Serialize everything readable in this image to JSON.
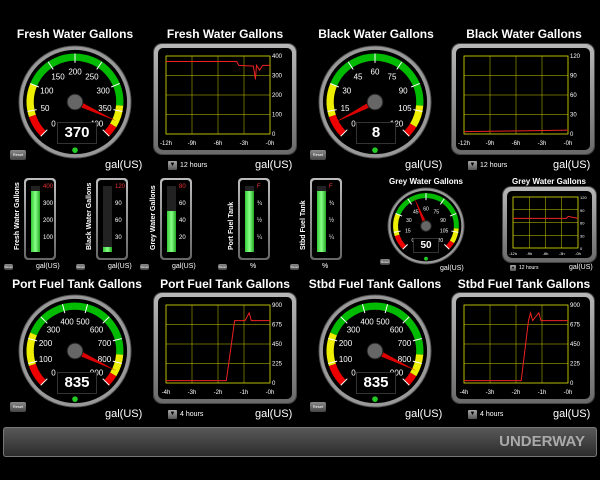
{
  "gauges": [
    {
      "id": "fresh",
      "title": "Fresh Water Gallons",
      "value": "370",
      "unit": "gal(US)",
      "max": 400,
      "ticks": [
        "0",
        "50",
        "100",
        "150",
        "200",
        "250",
        "300",
        "350",
        "400"
      ],
      "needle": 370
    },
    {
      "id": "black",
      "title": "Black Water Gallons",
      "value": "8",
      "unit": "gal(US)",
      "max": 120,
      "ticks": [
        "0",
        "15",
        "30",
        "45",
        "60",
        "75",
        "90",
        "105",
        "120"
      ],
      "needle": 8
    },
    {
      "id": "port",
      "title": "Port Fuel Tank Gallons",
      "value": "835",
      "unit": "gal(US)",
      "max": 900,
      "ticks": [
        "0",
        "100",
        "200",
        "300",
        "400",
        "500",
        "600",
        "700",
        "800",
        "900"
      ],
      "needle": 835
    },
    {
      "id": "stbd",
      "title": "Stbd Fuel Tank Gallons",
      "value": "835",
      "unit": "gal(US)",
      "max": 900,
      "ticks": [
        "0",
        "100",
        "200",
        "300",
        "400",
        "500",
        "600",
        "700",
        "800",
        "900"
      ],
      "needle": 835
    },
    {
      "id": "grey",
      "title": "Grey Water Gallons",
      "value": "50",
      "unit": "gal(US)",
      "max": 120,
      "ticks": [
        "0",
        "15",
        "30",
        "45",
        "60",
        "75",
        "90",
        "105",
        "120"
      ],
      "needle": 50
    }
  ],
  "trends": [
    {
      "id": "fresh",
      "title": "Fresh Water Gallons",
      "unit": "gal(US)",
      "range": "12 hours",
      "yticks": [
        "0",
        "100",
        "200",
        "300",
        "400"
      ],
      "xticks": [
        "-12h",
        "-9h",
        "-6h",
        "-3h",
        "-0h"
      ]
    },
    {
      "id": "black",
      "title": "Black Water Gallons",
      "unit": "gal(US)",
      "range": "12 hours",
      "yticks": [
        "0",
        "30",
        "60",
        "90",
        "120"
      ],
      "xticks": [
        "-12h",
        "-9h",
        "-6h",
        "-3h",
        "-0h"
      ]
    },
    {
      "id": "grey",
      "title": "Grey Water Gallons",
      "unit": "gal(US)",
      "range": "12 hours",
      "yticks": [
        "0",
        "30",
        "60",
        "90",
        "120"
      ],
      "xticks": [
        "-12h",
        "-9h",
        "-6h",
        "-3h",
        "-0h"
      ]
    },
    {
      "id": "port",
      "title": "Port Fuel Tank Gallons",
      "unit": "gal(US)",
      "range": "4 hours",
      "yticks": [
        "0",
        "225",
        "450",
        "675",
        "900"
      ],
      "xticks": [
        "-4h",
        "-3h",
        "-2h",
        "-1h",
        "-0h"
      ]
    },
    {
      "id": "stbd",
      "title": "Stbd Fuel Tank Gallons",
      "unit": "gal(US)",
      "range": "4 hours",
      "yticks": [
        "0",
        "225",
        "450",
        "675",
        "900"
      ],
      "xticks": [
        "-4h",
        "-3h",
        "-2h",
        "-1h",
        "-0h"
      ]
    }
  ],
  "bars": [
    {
      "label": "Fresh Water Gallons",
      "unit": "gal(US)",
      "ticks": [
        "400",
        "300",
        "200",
        "100"
      ],
      "level": 0.92
    },
    {
      "label": "Black Water Gallons",
      "unit": "gal(US)",
      "ticks": [
        "120",
        "90",
        "60",
        "30"
      ],
      "level": 0.07
    },
    {
      "label": "Grey Water Gallons",
      "unit": "gal(US)",
      "ticks": [
        "80",
        "60",
        "40",
        "20"
      ],
      "level": 0.62
    },
    {
      "label": "Port Fuel Tank",
      "unit": "%",
      "ticks": [
        "F",
        "¾",
        "½",
        "¼"
      ],
      "level": 0.93
    },
    {
      "label": "Stbd Fuel Tank",
      "unit": "%",
      "ticks": [
        "F",
        "¾",
        "½",
        "¼"
      ],
      "level": 0.93
    }
  ],
  "reset_label": "Reset",
  "status": "UNDERWAY"
}
